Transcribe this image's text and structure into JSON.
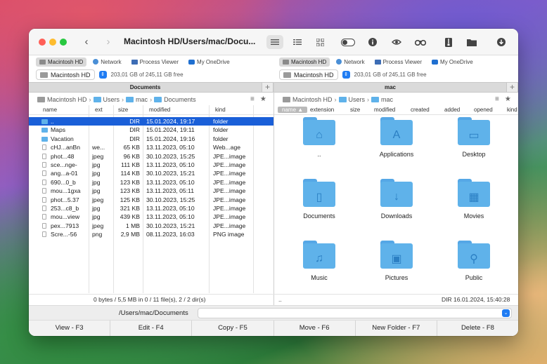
{
  "window": {
    "title": "Macintosh HD/Users/mac/Docu...",
    "nav_back": "‹",
    "nav_forward": "›"
  },
  "toolbar": {
    "icons": [
      "list-view-icon",
      "detail-view-icon",
      "grid-view-icon",
      "toggle-icon",
      "info-icon",
      "eye-icon",
      "binoculars-icon",
      "archive-icon",
      "folder-icon",
      "download-icon"
    ]
  },
  "left": {
    "drives": [
      "Macintosh HD",
      "Network",
      "Process Viewer",
      "My OneDrive"
    ],
    "disk": {
      "name": "Macintosh HD",
      "free": "203,01 GB of 245,11 GB free"
    },
    "tab": "Documents",
    "path": [
      "Macintosh HD",
      "Users",
      "mac",
      "Documents"
    ],
    "columns": [
      "name",
      "ext",
      "size",
      "modified",
      "kind"
    ],
    "files": [
      {
        "name": "..",
        "ext": "",
        "size": "DIR",
        "modified": "15.01.2024, 19:17",
        "kind": "folder",
        "type": "dir",
        "selected": true
      },
      {
        "name": "Maps",
        "ext": "",
        "size": "DIR",
        "modified": "15.01.2024, 19:11",
        "kind": "folder",
        "type": "dir"
      },
      {
        "name": "Vacation",
        "ext": "",
        "size": "DIR",
        "modified": "15.01.2024, 19:16",
        "kind": "folder",
        "type": "dir"
      },
      {
        "name": "cHJ...anBn",
        "ext": "we...",
        "size": "65 KB",
        "modified": "13.11.2023, 05:10",
        "kind": "Web...age",
        "type": "file"
      },
      {
        "name": "phot...48",
        "ext": "jpeg",
        "size": "96 KB",
        "modified": "30.10.2023, 15:25",
        "kind": "JPE...image",
        "type": "file"
      },
      {
        "name": "sce...nge-",
        "ext": "jpg",
        "size": "111 KB",
        "modified": "13.11.2023, 05:10",
        "kind": "JPE...image",
        "type": "file"
      },
      {
        "name": "ang...a-01",
        "ext": "jpg",
        "size": "114 KB",
        "modified": "30.10.2023, 15:21",
        "kind": "JPE...image",
        "type": "file"
      },
      {
        "name": "690...0_b",
        "ext": "jpg",
        "size": "123 KB",
        "modified": "13.11.2023, 05:10",
        "kind": "JPE...image",
        "type": "file"
      },
      {
        "name": "mou...1gxa",
        "ext": "jpg",
        "size": "123 KB",
        "modified": "13.11.2023, 05:11",
        "kind": "JPE...image",
        "type": "file"
      },
      {
        "name": "phot...5.37",
        "ext": "jpeg",
        "size": "125 KB",
        "modified": "30.10.2023, 15:25",
        "kind": "JPE...image",
        "type": "file"
      },
      {
        "name": "253...c8_b",
        "ext": "jpg",
        "size": "321 KB",
        "modified": "13.11.2023, 05:10",
        "kind": "JPE...image",
        "type": "file"
      },
      {
        "name": "mou...view",
        "ext": "jpg",
        "size": "439 KB",
        "modified": "13.11.2023, 05:10",
        "kind": "JPE...image",
        "type": "file"
      },
      {
        "name": "pex...7913",
        "ext": "jpeg",
        "size": "1 MB",
        "modified": "30.10.2023, 15:21",
        "kind": "JPE...image",
        "type": "file"
      },
      {
        "name": "Scre...-56",
        "ext": "png",
        "size": "2,9 MB",
        "modified": "08.11.2023, 16:03",
        "kind": "PNG image",
        "type": "file"
      }
    ],
    "status": "0 bytes / 5,5 MB in 0 / 11 file(s), 2 / 2 dir(s)"
  },
  "right": {
    "drives": [
      "Macintosh HD",
      "Network",
      "Process Viewer",
      "My OneDrive"
    ],
    "disk": {
      "name": "Macintosh HD",
      "free": "203,01 GB of 245,11 GB free"
    },
    "tab": "mac",
    "path": [
      "Macintosh HD",
      "Users",
      "mac"
    ],
    "columns": [
      "name ▲",
      "extension",
      "size",
      "modified",
      "created",
      "added",
      "opened",
      "kind"
    ],
    "folders": [
      {
        "name": "..",
        "glyph": "⌂"
      },
      {
        "name": "Applications",
        "glyph": "A"
      },
      {
        "name": "Desktop",
        "glyph": "▭"
      },
      {
        "name": "Documents",
        "glyph": "▯"
      },
      {
        "name": "Downloads",
        "glyph": "↓"
      },
      {
        "name": "Movies",
        "glyph": "▦"
      },
      {
        "name": "Music",
        "glyph": "♫"
      },
      {
        "name": "Pictures",
        "glyph": "▣"
      },
      {
        "name": "Public",
        "glyph": "⚲"
      }
    ],
    "status_left": "..",
    "status_right": "DIR  16.01.2024, 15:40:28"
  },
  "command": {
    "path": "/Users/mac/Documents",
    "value": ""
  },
  "fkeys": [
    "View - F3",
    "Edit - F4",
    "Copy - F5",
    "Move - F6",
    "New Folder - F7",
    "Delete - F8"
  ],
  "colors": {
    "accent": "#1a5fd8",
    "folder": "#5fb2ea"
  }
}
